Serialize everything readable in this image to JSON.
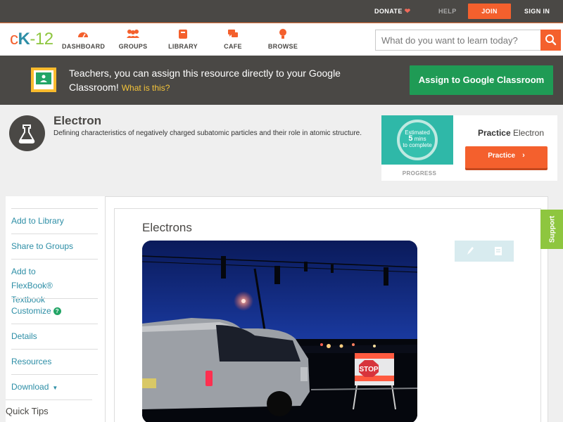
{
  "topbar": {
    "donate": "DONATE",
    "help": "HELP",
    "join": "JOIN",
    "sign_in": "SIGN IN"
  },
  "logo": {
    "c": "c",
    "k": "K",
    "dash": "-",
    "num": "12"
  },
  "nav": {
    "items": [
      {
        "label": "DASHBOARD",
        "icon": "dashboard-icon"
      },
      {
        "label": "GROUPS",
        "icon": "groups-icon"
      },
      {
        "label": "LIBRARY",
        "icon": "library-icon"
      },
      {
        "label": "CAFE",
        "icon": "cafe-icon"
      },
      {
        "label": "BROWSE",
        "icon": "browse-icon"
      }
    ],
    "search_placeholder": "What do you want to learn today?"
  },
  "classroom_banner": {
    "text": "Teachers, you can assign this resource directly to your Google Classroom!",
    "what_is_this": "What is this?",
    "button": "Assign to Google Classroom"
  },
  "concept": {
    "title": "Electron",
    "description": "Defining characteristics of negatively charged subatomic particles and their role in atomic structure."
  },
  "practice_card": {
    "estimated_line1": "Estimated",
    "estimated_value": "5",
    "estimated_unit": "mins",
    "estimated_line3": "to complete",
    "progress_label": "PROGRESS",
    "practice_prefix": "Practice",
    "practice_topic": "Electron",
    "practice_button": "Practice"
  },
  "sidebar": {
    "items": [
      "Add to Library",
      "Share to Groups",
      "Add to FlexBook® Textbook",
      "Customize",
      "Details",
      "Resources",
      "Download"
    ],
    "quick_tips": "Quick Tips"
  },
  "content": {
    "title": "Electrons",
    "image": {
      "description": "night street intersection with traffic lights, a white van and a STOP sign",
      "sign_text": "STOP"
    }
  },
  "support": "Support",
  "colors": {
    "brand_orange": "#f4602d",
    "brand_green": "#8ec63f",
    "brand_teal": "#2d8ea6",
    "classroom_green": "#1f9b55",
    "dark_bar": "#4a4845"
  }
}
